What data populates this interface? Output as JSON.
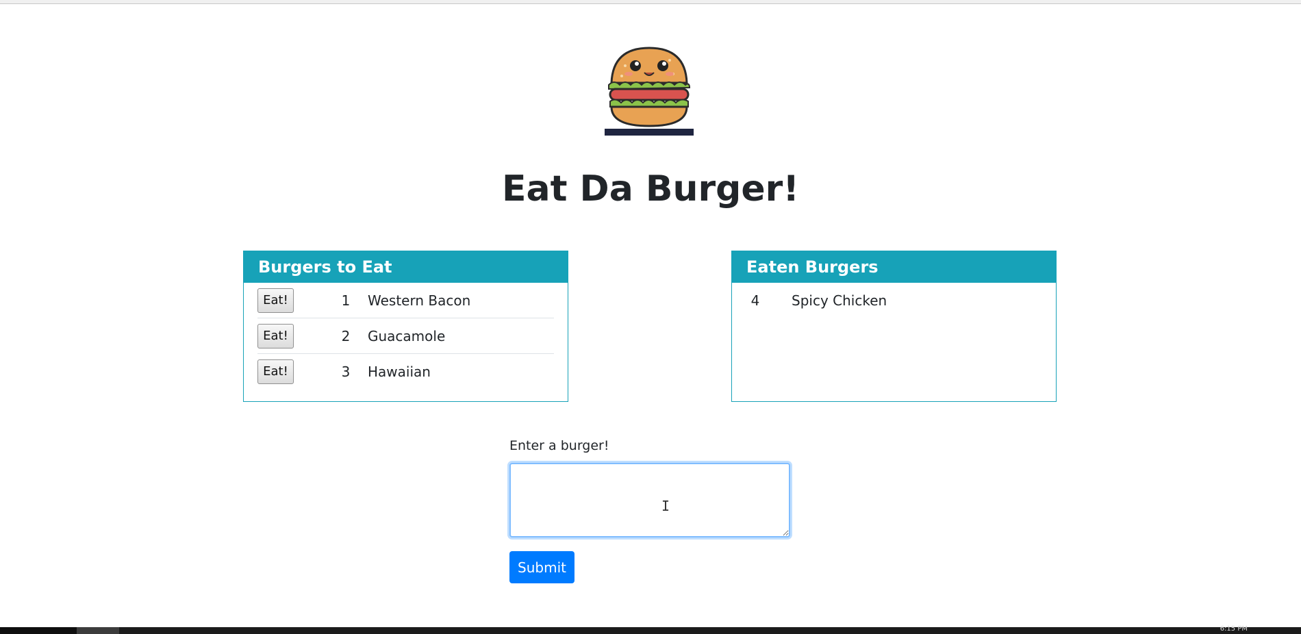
{
  "page": {
    "title": "Eat Da Burger!",
    "logo_icon": "burger-mascot-icon"
  },
  "to_eat": {
    "header": "Burgers to Eat",
    "button_label": "Eat!",
    "items": [
      {
        "id": "1",
        "name": "Western Bacon"
      },
      {
        "id": "2",
        "name": "Guacamole"
      },
      {
        "id": "3",
        "name": "Hawaiian"
      }
    ]
  },
  "eaten": {
    "header": "Eaten Burgers",
    "items": [
      {
        "id": "4",
        "name": "Spicy Chicken"
      }
    ]
  },
  "form": {
    "label": "Enter a burger!",
    "value": "",
    "submit_label": "Submit"
  },
  "taskbar": {
    "clock": "6:15 PM"
  },
  "colors": {
    "header_bg": "#17a2b8",
    "submit_bg": "#007bff"
  }
}
